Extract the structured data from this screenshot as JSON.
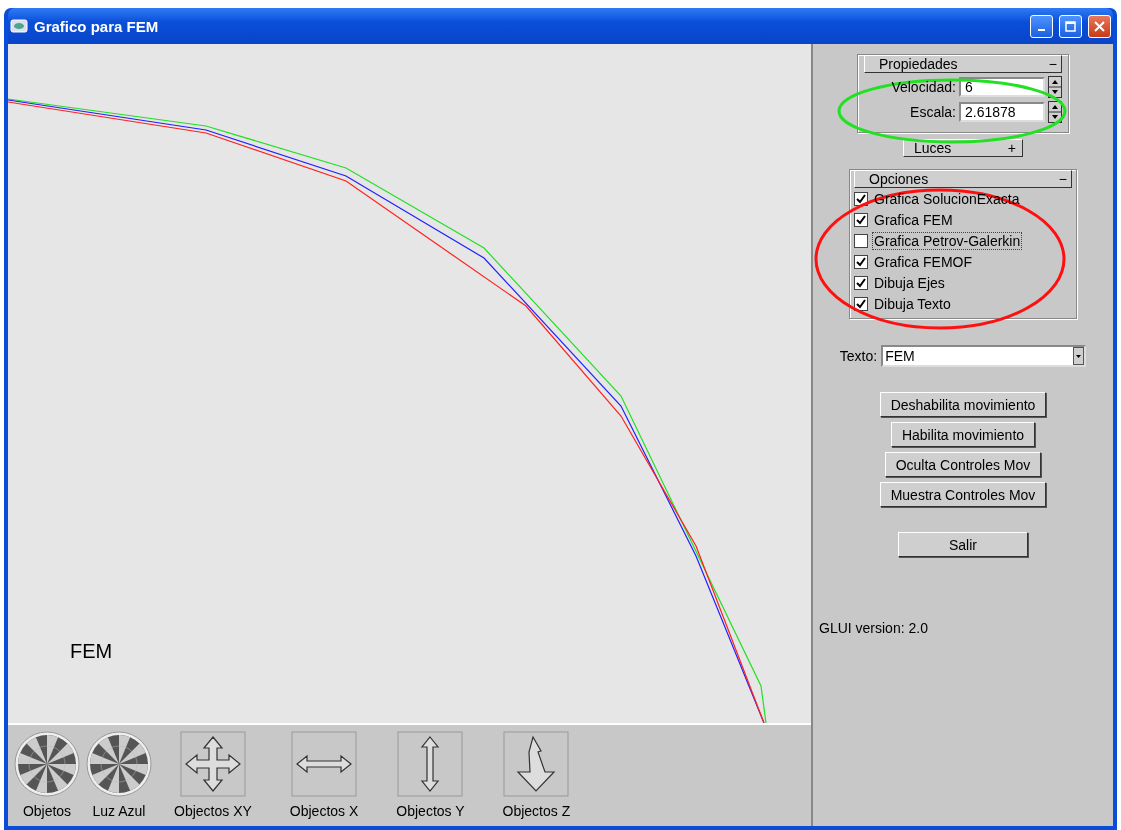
{
  "window": {
    "title": "Grafico para FEM"
  },
  "canvas": {
    "label": "FEM"
  },
  "toolbar": [
    {
      "kind": "ball",
      "label": "Objetos"
    },
    {
      "kind": "ball",
      "label": "Luz Azul"
    },
    {
      "kind": "xy",
      "label": "Objectos XY"
    },
    {
      "kind": "x",
      "label": "Objectos X"
    },
    {
      "kind": "y",
      "label": "Objectos Y"
    },
    {
      "kind": "z",
      "label": "Objectos Z"
    }
  ],
  "properties": {
    "title": "Propiedades",
    "toggle": "−",
    "fields": [
      {
        "label": "Velocidad:",
        "value": "6"
      },
      {
        "label": "Escala:",
        "value": "2.61878"
      }
    ]
  },
  "lights": {
    "title": "Luces",
    "toggle": "+"
  },
  "options": {
    "title": "Opciones",
    "toggle": "−",
    "items": [
      {
        "label": "Grafica SolucionExacta",
        "checked": true,
        "focused": false
      },
      {
        "label": "Grafica FEM",
        "checked": true,
        "focused": false
      },
      {
        "label": "Grafica Petrov-Galerkin",
        "checked": false,
        "focused": true
      },
      {
        "label": "Grafica FEMOF",
        "checked": true,
        "focused": false
      },
      {
        "label": "Dibuja Ejes",
        "checked": true,
        "focused": false
      },
      {
        "label": "Dibuja Texto",
        "checked": true,
        "focused": false
      }
    ]
  },
  "text_select": {
    "label": "Texto:",
    "value": "FEM"
  },
  "buttons": [
    "Deshabilita movimiento",
    "Habilita movimiento",
    "Oculta Controles Mov",
    "Muestra Controles Mov"
  ],
  "exit_button": "Salir",
  "version": "GLUI version: 2.0",
  "annotations": [
    {
      "color": "#22e022"
    },
    {
      "color": "#ff1010"
    }
  ]
}
